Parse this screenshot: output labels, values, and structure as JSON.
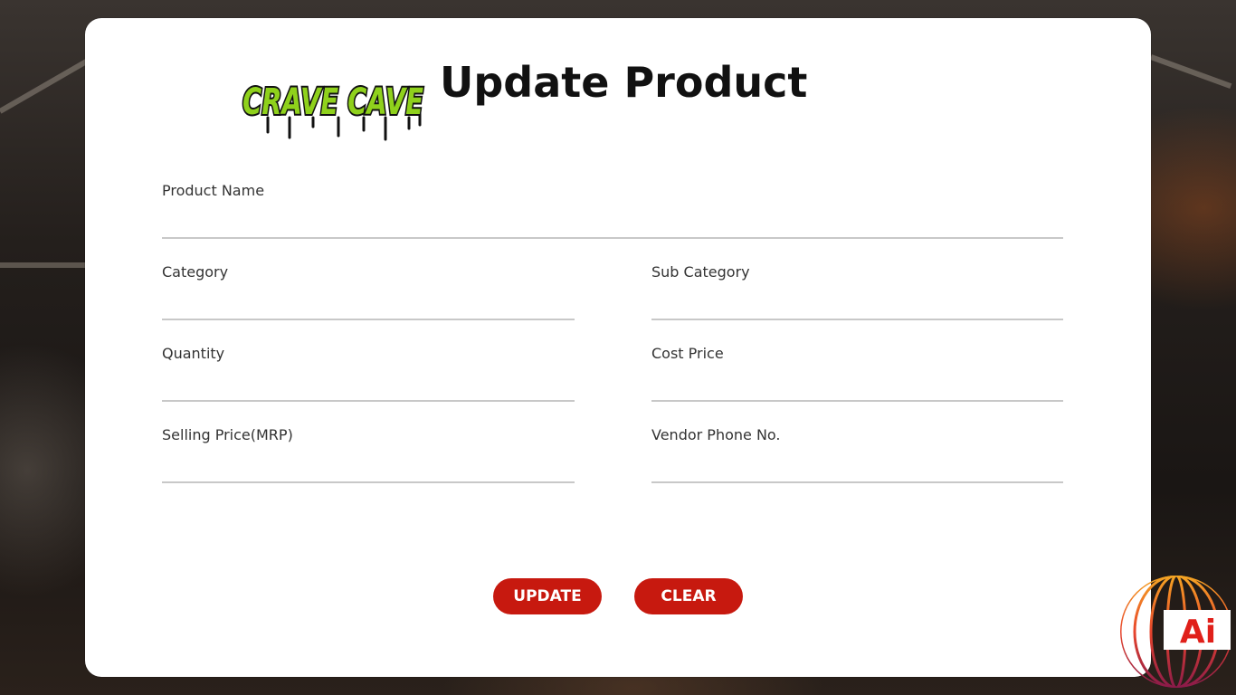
{
  "brand": {
    "logo_text": "CRAVE CAVE",
    "logo_color": "#8fd11c",
    "ai_badge_text": "Ai",
    "accent": "#c7190f"
  },
  "header": {
    "title": "Update Product"
  },
  "form": {
    "product_name": {
      "label": "Product Name",
      "value": ""
    },
    "category": {
      "label": "Category",
      "value": ""
    },
    "sub_category": {
      "label": "Sub Category",
      "value": ""
    },
    "quantity": {
      "label": "Quantity",
      "value": ""
    },
    "cost_price": {
      "label": "Cost Price",
      "value": ""
    },
    "selling_price": {
      "label": "Selling Price(MRP)",
      "value": ""
    },
    "vendor_phone": {
      "label": "Vendor Phone No.",
      "value": ""
    }
  },
  "actions": {
    "update_label": "UPDATE",
    "clear_label": "CLEAR"
  }
}
